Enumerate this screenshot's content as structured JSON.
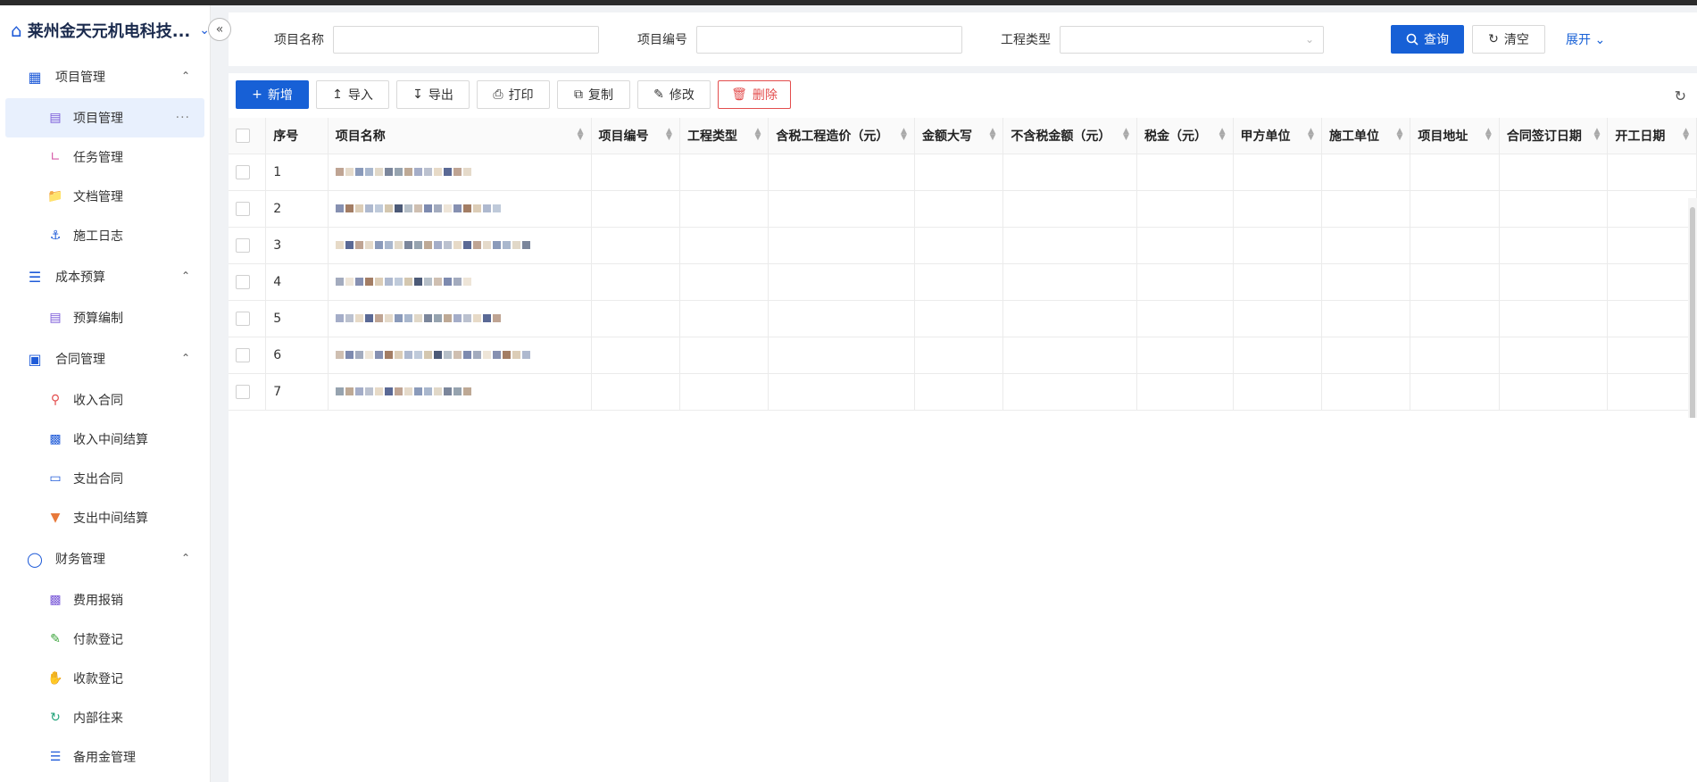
{
  "app": {
    "company": "莱州金天元机电科技...",
    "brand_color": "#1f5bd8"
  },
  "sidebar": {
    "groups": [
      {
        "label": "项目管理",
        "icon": "project-icon",
        "items": [
          {
            "label": "项目管理",
            "icon": "document-icon",
            "active": true
          },
          {
            "label": "任务管理",
            "icon": "chart-icon"
          },
          {
            "label": "文档管理",
            "icon": "folder-icon"
          },
          {
            "label": "施工日志",
            "icon": "worker-icon"
          }
        ]
      },
      {
        "label": "成本预算",
        "icon": "stack-icon",
        "items": [
          {
            "label": "预算编制",
            "icon": "notebook-icon"
          }
        ]
      },
      {
        "label": "合同管理",
        "icon": "briefcase-icon",
        "items": [
          {
            "label": "收入合同",
            "icon": "pin-icon"
          },
          {
            "label": "收入中间结算",
            "icon": "money-icon"
          },
          {
            "label": "支出合同",
            "icon": "pay-icon"
          },
          {
            "label": "支出中间结算",
            "icon": "funnel-icon"
          }
        ]
      },
      {
        "label": "财务管理",
        "icon": "coins-icon",
        "items": [
          {
            "label": "费用报销",
            "icon": "cash-icon"
          },
          {
            "label": "付款登记",
            "icon": "edit-icon"
          },
          {
            "label": "收款登记",
            "icon": "hand-coin-icon"
          },
          {
            "label": "内部往来",
            "icon": "sync-icon"
          },
          {
            "label": "备用金管理",
            "icon": "layers-icon"
          }
        ]
      }
    ]
  },
  "search": {
    "project_name_label": "项目名称",
    "project_no_label": "项目编号",
    "type_label": "工程类型",
    "query_label": "查询",
    "clear_label": "清空",
    "expand_label": "展开"
  },
  "toolbar": {
    "add": "新增",
    "import": "导入",
    "export": "导出",
    "print": "打印",
    "copy": "复制",
    "edit": "修改",
    "delete": "删除"
  },
  "table": {
    "columns": [
      "序号",
      "项目名称",
      "项目编号",
      "工程类型",
      "含税工程造价（元）",
      "金额大写",
      "不含税金额（元）",
      "税金（元）",
      "甲方单位",
      "施工单位",
      "项目地址",
      "合同签订日期",
      "开工日期"
    ],
    "rows": [
      "1",
      "2",
      "3",
      "4",
      "5",
      "6",
      "7"
    ]
  }
}
